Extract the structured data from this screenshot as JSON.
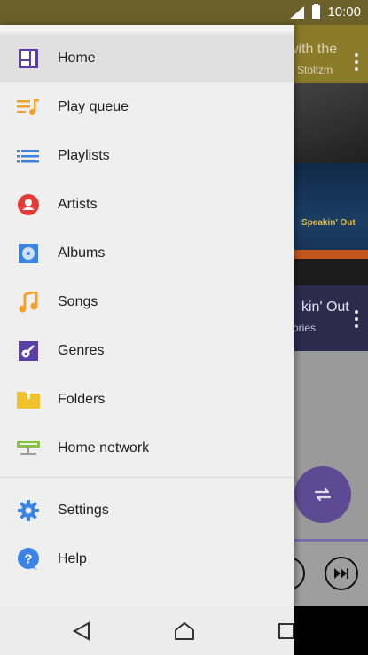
{
  "status": {
    "time": "10:00"
  },
  "background": {
    "top_title": "with the",
    "top_subtitle": "Stoltzm",
    "album_art_text": "Speakin' Out",
    "list_title": "kin' Out",
    "list_subtitle": "ories"
  },
  "drawer": {
    "items": [
      {
        "label": "Home",
        "icon": "home-grid-icon",
        "color": "#5b3fa6",
        "selected": true
      },
      {
        "label": "Play queue",
        "icon": "play-queue-icon",
        "color": "#f2a22a"
      },
      {
        "label": "Playlists",
        "icon": "playlists-icon",
        "color": "#3b84e6"
      },
      {
        "label": "Artists",
        "icon": "artist-icon",
        "color": "#e53935"
      },
      {
        "label": "Albums",
        "icon": "album-icon",
        "color": "#3b84e6"
      },
      {
        "label": "Songs",
        "icon": "music-note-icon",
        "color": "#f2a22a"
      },
      {
        "label": "Genres",
        "icon": "guitar-icon",
        "color": "#5b3fa6"
      },
      {
        "label": "Folders",
        "icon": "folder-icon",
        "color": "#f2c12e"
      },
      {
        "label": "Home network",
        "icon": "home-network-icon",
        "color": "#8bc34a"
      }
    ],
    "bottom_items": [
      {
        "label": "Settings",
        "icon": "settings-gear-icon",
        "color": "#3b84e6"
      },
      {
        "label": "Help",
        "icon": "help-icon",
        "color": "#3b84e6"
      }
    ]
  },
  "navbar": {
    "back": "back-icon",
    "home": "home-icon",
    "recents": "recents-icon"
  }
}
